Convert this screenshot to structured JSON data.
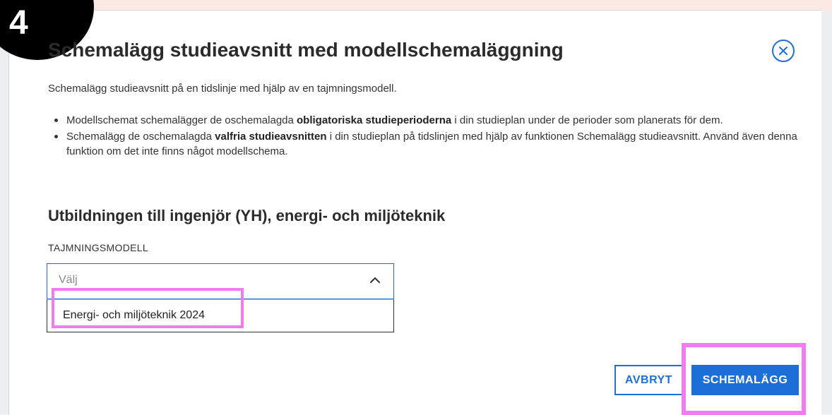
{
  "step_badge": "4",
  "dialog": {
    "title": "Schemalägg studieavsnitt med modellschemaläggning",
    "close_icon": "close-circle-icon",
    "intro": "Schemalägg studieavsnitt på en tidslinje med hjälp av en tajmningsmodell.",
    "bullets": [
      {
        "before": "Modellschemat schemalägger de oschemalagda ",
        "bold": "obligatoriska studieperioderna",
        "after": " i din studieplan under de perioder som planerats för dem."
      },
      {
        "before": "Schemalägg de oschemalagda ",
        "bold": "valfria studieavsnitten",
        "after": " i din studieplan på tidslinjen med hjälp av funktionen Schemalägg studieavsnitt. Använd även denna funktion om det inte finns något modellschema."
      }
    ],
    "section_heading": "Utbildningen till ingenjör (YH), energi- och miljöteknik",
    "field_label": "TAJMNINGSMODELL",
    "select": {
      "placeholder": "Välj",
      "options": [
        "Energi- och miljöteknik 2024"
      ]
    },
    "buttons": {
      "cancel": "AVBRYT",
      "primary": "SCHEMALÄGG"
    }
  },
  "colors": {
    "accent": "#1d6fd8",
    "highlight": "#f07cf0"
  }
}
